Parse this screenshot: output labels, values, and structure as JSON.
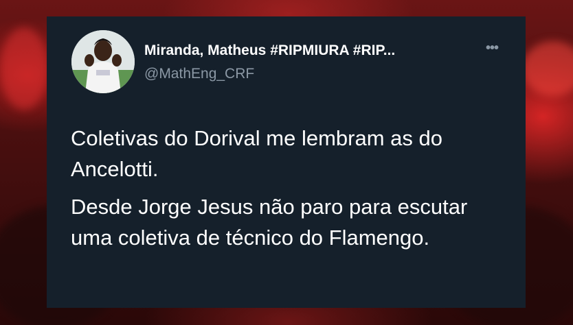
{
  "tweet": {
    "display_name": "Miranda, Matheus #RIPMIURA #RIP...",
    "handle": "@MathEng_CRF",
    "more_icon": "ellipsis-icon",
    "avatar_icon": "profile-avatar",
    "paragraphs": [
      "Coletivas do Dorival me lembram as do Ancelotti.",
      "Desde Jorge Jesus não paro para escutar uma coletiva de técnico do Flamengo."
    ]
  },
  "colors": {
    "card_background": "#15202b",
    "name_color": "#ffffff",
    "handle_color": "#8b98a5",
    "backdrop_accent": "#c41e1e"
  }
}
